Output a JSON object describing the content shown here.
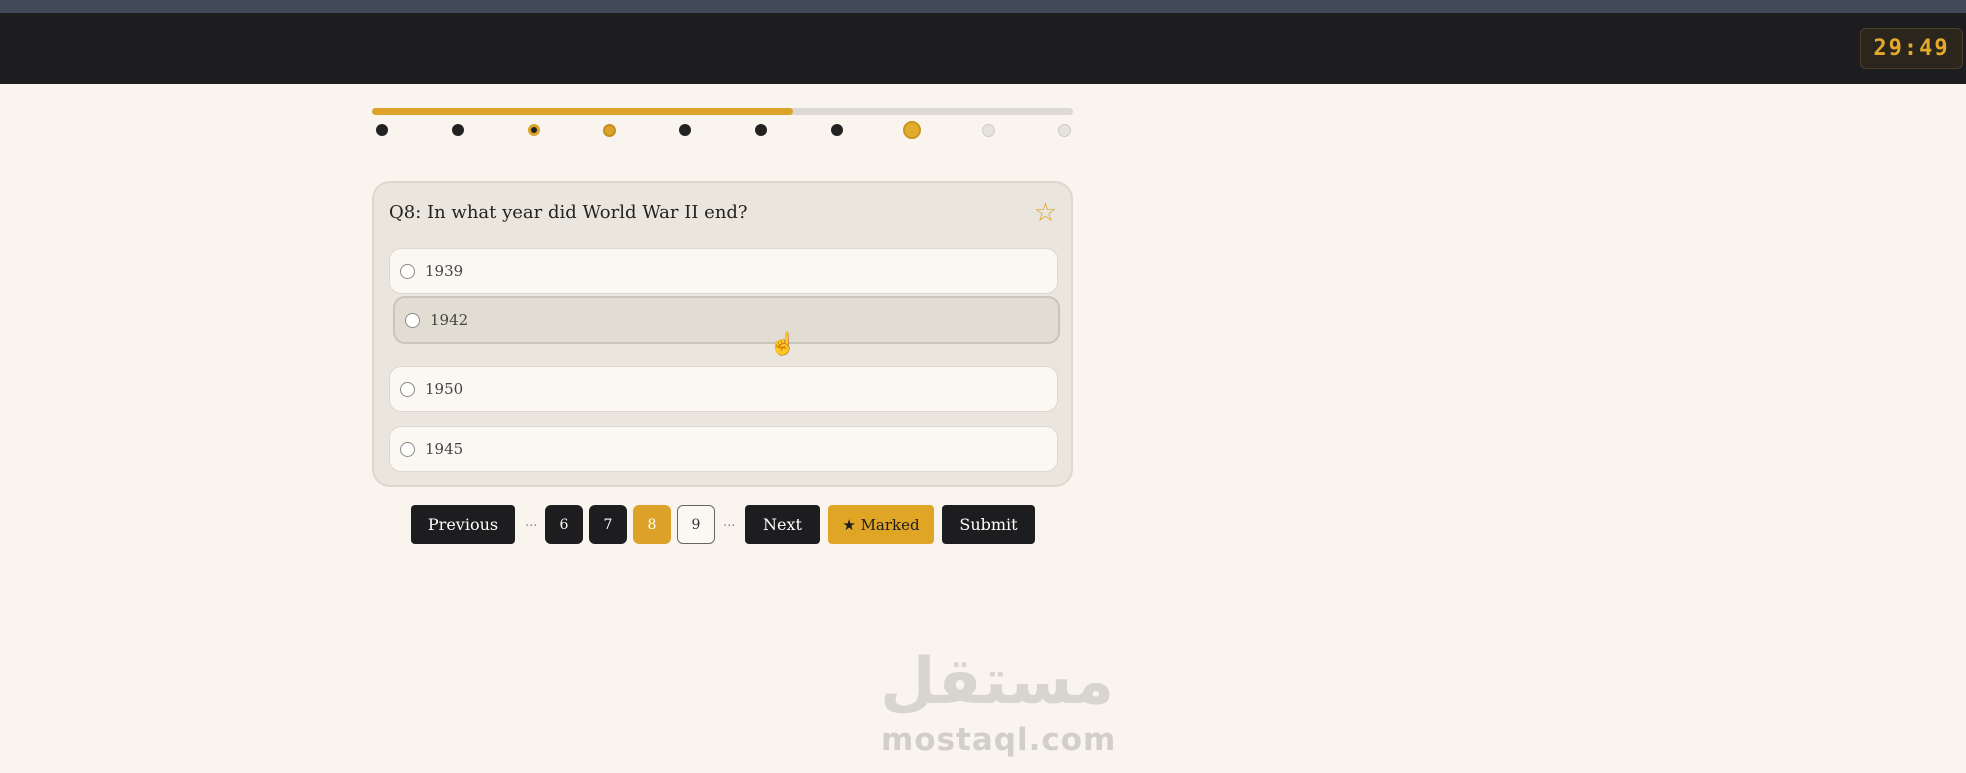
{
  "timer": "29:49",
  "progress": {
    "fraction": 0.6
  },
  "question_dots": [
    {
      "status": "answered"
    },
    {
      "status": "answered"
    },
    {
      "status": "marked-answered"
    },
    {
      "status": "marked"
    },
    {
      "status": "answered"
    },
    {
      "status": "answered"
    },
    {
      "status": "answered"
    },
    {
      "status": "current"
    },
    {
      "status": "empty"
    },
    {
      "status": "empty"
    }
  ],
  "question": {
    "text": "Q8: In what year did World War II end?",
    "star_icon": "☆",
    "options": [
      {
        "label": "1939"
      },
      {
        "label": "1942",
        "hovered": true
      },
      {
        "label": "1950"
      },
      {
        "label": "1945"
      }
    ]
  },
  "pagination": {
    "previous_label": "Previous",
    "ellipsis_left": "...",
    "pages": [
      "6",
      "7",
      "8",
      "9"
    ],
    "current_page": "8",
    "ellipsis_right": "...",
    "next_label": "Next",
    "marked_label": "★ Marked",
    "submit_label": "Submit"
  },
  "watermark": {
    "arabic": "مستقل",
    "latin": "mostaql.com"
  },
  "colors": {
    "accent": "#dca22a",
    "dark": "#1d1d1f",
    "background": "#f9f4ee"
  }
}
